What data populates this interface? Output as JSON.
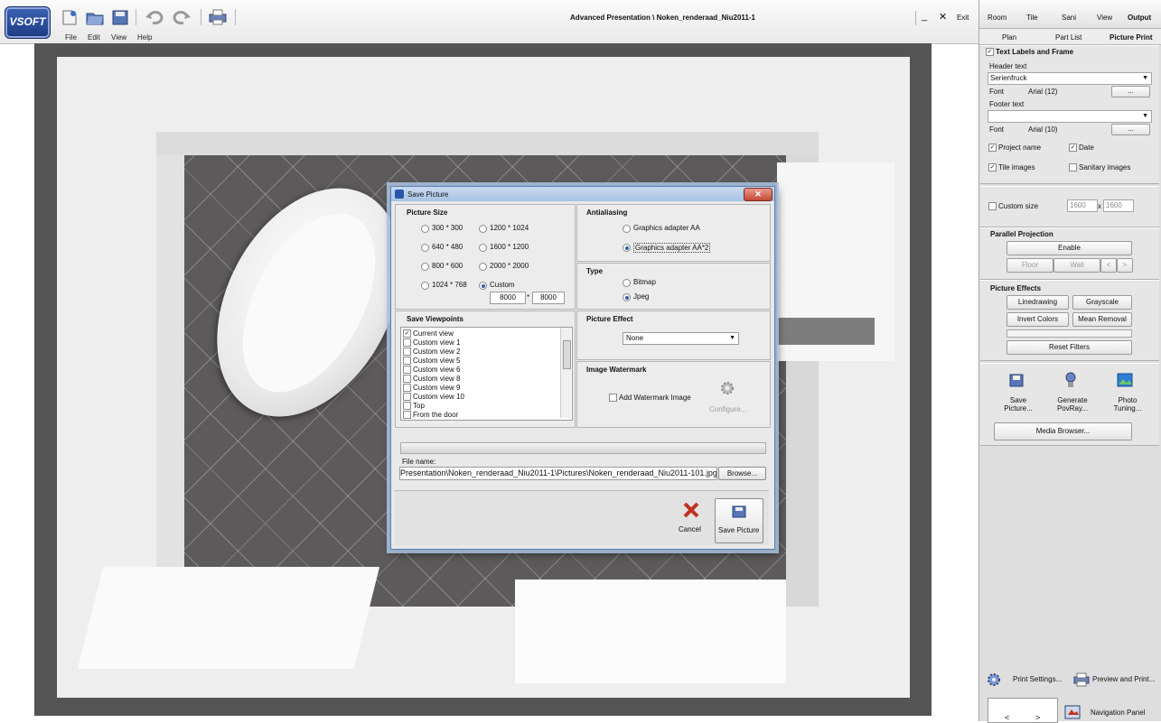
{
  "app": {
    "logo_text": "VSOFT",
    "title": "Advanced Presentation \\ Noken_renderaad_Niu2011-1",
    "window_buttons": {
      "minimize": "_",
      "close": "✕",
      "exit": "Exit"
    },
    "menu": [
      "File",
      "Edit",
      "View",
      "Help"
    ],
    "toolbar_icons": [
      "new-icon",
      "open-icon",
      "save-icon",
      "undo-icon",
      "redo-icon",
      "print-icon"
    ]
  },
  "right_panel": {
    "tabs_row1": [
      "Room",
      "Tile",
      "Sani",
      "View",
      "Output"
    ],
    "active_tab_row1": "Output",
    "tabs_row2": [
      "Plan",
      "Part List",
      "Picture Print"
    ],
    "active_tab_row2": "Picture Print",
    "text_labels": {
      "title": "Text Labels and Frame",
      "checked": true,
      "header_label": "Header text",
      "header_value": "Serienfruck",
      "font_label": "Font",
      "header_font": "Arial (12)",
      "dots": "...",
      "footer_label": "Footer text",
      "footer_value": "",
      "footer_font": "Arial (10)",
      "options": [
        {
          "label": "Project name",
          "checked": true
        },
        {
          "label": "Date",
          "checked": true
        },
        {
          "label": "Tile images",
          "checked": true
        },
        {
          "label": "Sanitary images",
          "checked": false
        }
      ]
    },
    "custom_size": {
      "label": "Custom size",
      "checked": false,
      "width": "1600",
      "x": "x",
      "height": "1600"
    },
    "parallel_projection": {
      "title": "Parallel Projection",
      "enable": "Enable",
      "floor": "Floor",
      "wall": "Wall",
      "prev": "<",
      "next": ">"
    },
    "picture_effects": {
      "title": "Picture Effects",
      "buttons": [
        "Linedrawing",
        "Grayscale",
        "Invert Colors",
        "Mean Removal"
      ],
      "reset": "Reset Filters"
    },
    "actions": [
      {
        "label": "Save Picture...",
        "icon": "save-picture-icon"
      },
      {
        "label": "Generate PovRay...",
        "icon": "povray-icon"
      },
      {
        "label": "Photo Tuning...",
        "icon": "photo-tuning-icon"
      }
    ],
    "media_browser": "Media Browser...",
    "print_settings": "Print Settings...",
    "preview_print": "Preview and Print...",
    "navigation_panel": "Navigation Panel",
    "nav_prev": "<",
    "nav_next": ">"
  },
  "dialog": {
    "title": "Save Picture",
    "close": "✕",
    "picture_size": {
      "title": "Picture Size",
      "options": [
        {
          "label": "300 * 300",
          "selected": false
        },
        {
          "label": "1200 * 1024",
          "selected": false
        },
        {
          "label": "640 * 480",
          "selected": false
        },
        {
          "label": "1600 * 1200",
          "selected": false
        },
        {
          "label": "800 * 600",
          "selected": false
        },
        {
          "label": "2000 * 2000",
          "selected": false
        },
        {
          "label": "1024 * 768",
          "selected": false
        },
        {
          "label": "Custom",
          "selected": true
        }
      ],
      "custom_width": "8000",
      "custom_sep": "*",
      "custom_height": "8000"
    },
    "antialiasing": {
      "title": "Antialiasing",
      "options": [
        {
          "label": "Graphics adapter AA",
          "selected": false
        },
        {
          "label": "Graphics adapter AA*2",
          "selected": true
        }
      ]
    },
    "type": {
      "title": "Type",
      "options": [
        {
          "label": "Bitmap",
          "selected": false
        },
        {
          "label": "Jpeg",
          "selected": true
        }
      ]
    },
    "save_viewpoints": {
      "title": "Save Viewpoints",
      "items": [
        {
          "label": "Current view",
          "checked": true
        },
        {
          "label": "Custom view 1",
          "checked": false
        },
        {
          "label": "Custom view 2",
          "checked": false
        },
        {
          "label": "Custom view 5",
          "checked": false
        },
        {
          "label": "Custom view 6",
          "checked": false
        },
        {
          "label": "Custom view 8",
          "checked": false
        },
        {
          "label": "Custom view 9",
          "checked": false
        },
        {
          "label": "Custom view 10",
          "checked": false
        },
        {
          "label": "Top",
          "checked": false
        },
        {
          "label": "From the door",
          "checked": false
        }
      ]
    },
    "picture_effect": {
      "title": "Picture Effect",
      "value": "None"
    },
    "image_watermark": {
      "title": "Image Watermark",
      "checkbox": "Add Watermark Image",
      "checked": false,
      "configure": "Configure..."
    },
    "file_name_label": "File name:",
    "file_name": "Presentation\\Noken_renderaad_Niu2011-1\\Pictures\\Noken_renderaad_Niu2011-101.jpg",
    "browse": "Browse...",
    "cancel": "Cancel",
    "save": "Save Picture"
  }
}
